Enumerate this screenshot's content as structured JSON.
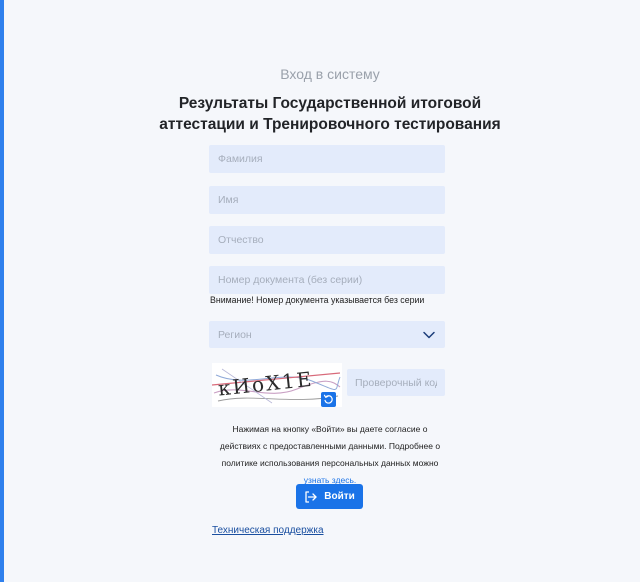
{
  "header": {
    "subtitle": "Вход в систему",
    "title_line1": "Результаты Государственной итоговой",
    "title_line2": "аттестации и Тренировочного тестирования"
  },
  "form": {
    "lastname_placeholder": "Фамилия",
    "firstname_placeholder": "Имя",
    "middlename_placeholder": "Отчество",
    "document_placeholder": "Номер документа (без серии)",
    "document_note": "Внимание! Номер документа указывается без серии",
    "region_placeholder": "Регион",
    "captcha_text": "кИоХ1Е",
    "captcha_placeholder": "Проверочный код"
  },
  "consent": {
    "line1": "Нажимая на кнопку «Войти» вы даете согласие о",
    "line2": "действиях с предоставленными данными. Подробнее о",
    "line3": "политике использования персональных данных можно",
    "link": "узнать здесь."
  },
  "actions": {
    "login_label": "Войти",
    "support_label": "Техническая поддержка"
  },
  "colors": {
    "accent": "#1a73e8",
    "field_bg": "#e3ebfb",
    "page_bg": "#f5f7fb"
  },
  "icons": {
    "region_toggle": "chevron-down-icon",
    "captcha_refresh": "refresh-icon",
    "login": "login-arrow-icon"
  }
}
